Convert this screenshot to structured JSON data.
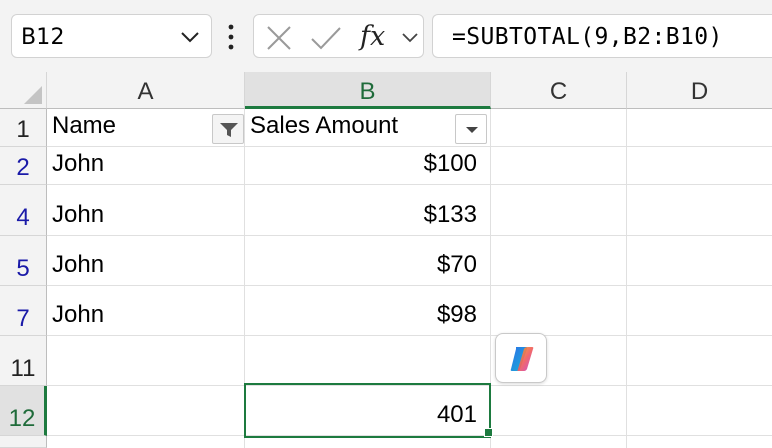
{
  "formula_bar": {
    "name_box": "B12",
    "name_box_icon": "chevron-down-icon",
    "more_icon": "vertical-dots-icon",
    "cancel_icon": "x-icon",
    "enter_icon": "check-icon",
    "function_label": "fx",
    "expand_icon": "chevron-down-icon",
    "formula": "=SUBTOTAL(9,B2:B10)"
  },
  "columns": [
    "A",
    "B",
    "C",
    "D"
  ],
  "rows": [
    {
      "number": "1",
      "a": "Name",
      "b": "Sales Amount"
    },
    {
      "number": "2",
      "a": "John",
      "b": "$100"
    },
    {
      "number": "4",
      "a": "John",
      "b": "$133"
    },
    {
      "number": "5",
      "a": "John",
      "b": "$70"
    },
    {
      "number": "7",
      "a": "John",
      "b": "$98"
    },
    {
      "number": "11",
      "a": "",
      "b": ""
    },
    {
      "number": "12",
      "a": "",
      "b": "401"
    }
  ],
  "filters": {
    "name_filter": "filter-applied-icon",
    "sales_filter": "filter-dropdown-icon"
  },
  "copilot_icon": "copilot-icon",
  "colors": {
    "selection": "#1d7a3f",
    "filtered_row_numbers": "#1a1aa8",
    "header_bg": "#f3f3f3"
  }
}
